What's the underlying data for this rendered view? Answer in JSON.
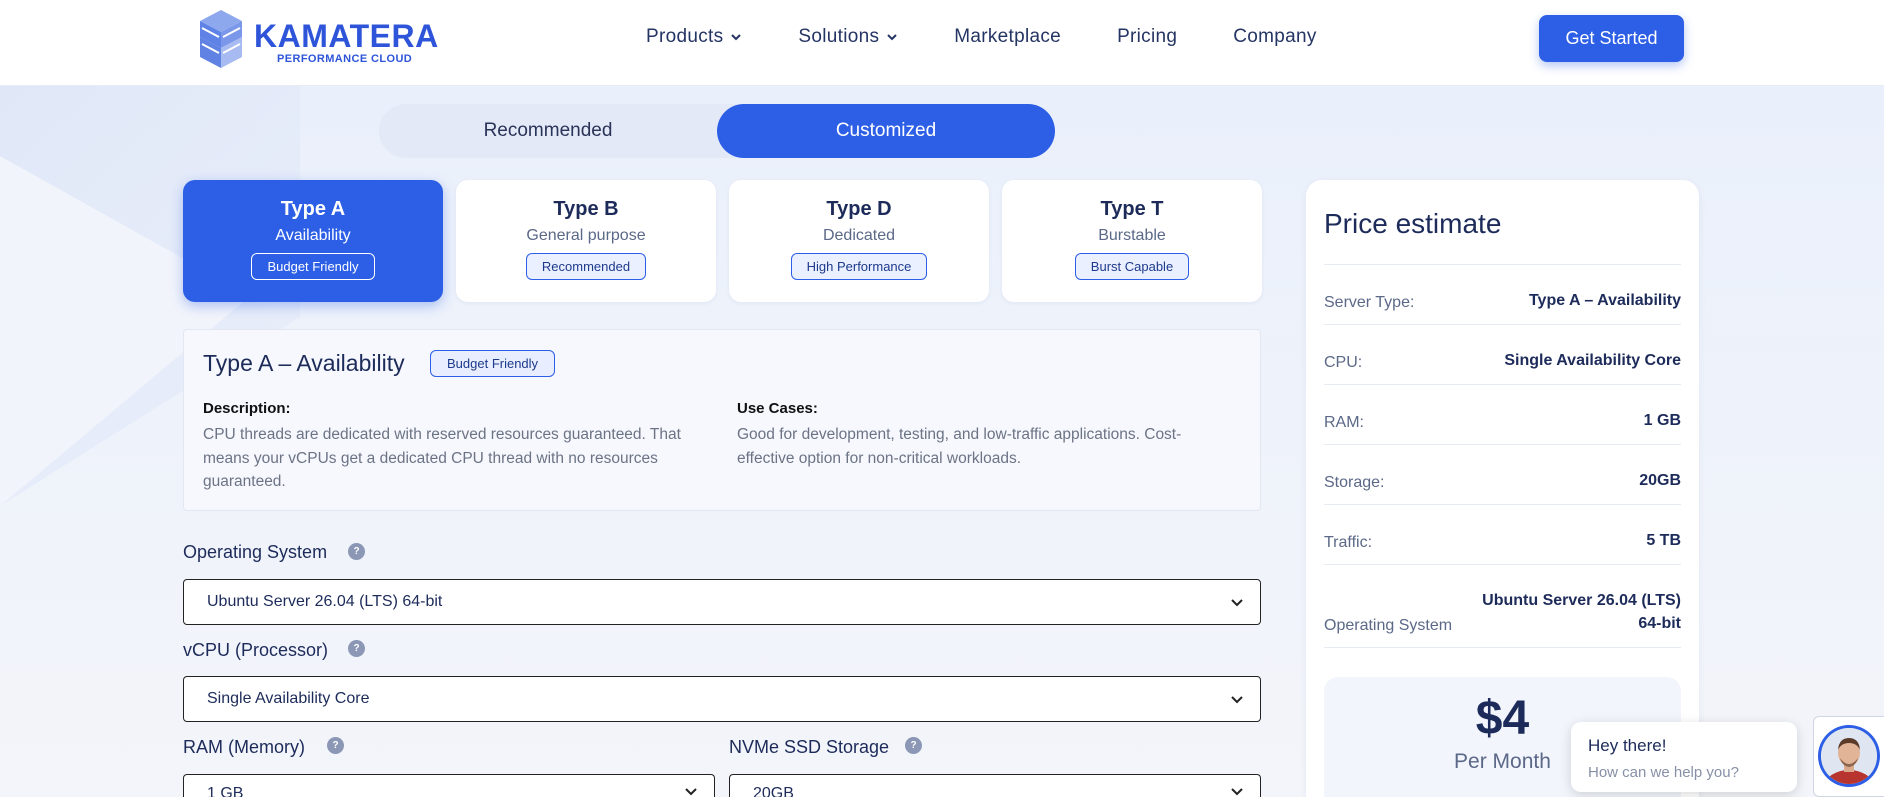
{
  "header": {
    "logo": {
      "name": "KAMATERA",
      "tagline": "PERFORMANCE CLOUD"
    },
    "nav": [
      {
        "label": "Products",
        "dropdown": true
      },
      {
        "label": "Solutions",
        "dropdown": true
      },
      {
        "label": "Marketplace",
        "dropdown": false
      },
      {
        "label": "Pricing",
        "dropdown": false
      },
      {
        "label": "Company",
        "dropdown": false
      }
    ],
    "cta_label": "Get Started"
  },
  "mode_toggle": {
    "left": "Recommended",
    "right": "Customized",
    "selected": "Customized"
  },
  "server_types": [
    {
      "title": "Type A",
      "subtitle": "Availability",
      "badge": "Budget Friendly",
      "selected": true
    },
    {
      "title": "Type B",
      "subtitle": "General purpose",
      "badge": "Recommended",
      "selected": false
    },
    {
      "title": "Type D",
      "subtitle": "Dedicated",
      "badge": "High Performance",
      "selected": false
    },
    {
      "title": "Type T",
      "subtitle": "Burstable",
      "badge": "Burst Capable",
      "selected": false
    }
  ],
  "details": {
    "title": "Type A – Availability",
    "badge": "Budget Friendly",
    "description_label": "Description:",
    "description": "CPU threads are dedicated with reserved resources guaranteed. That means your vCPUs get a dedicated CPU thread with no resources guaranteed.",
    "use_cases_label": "Use Cases:",
    "use_cases": "Good for development, testing, and low-traffic applications. Cost-effective option for non-critical workloads."
  },
  "form": {
    "os": {
      "label": "Operating System",
      "value": "Ubuntu Server 26.04 (LTS) 64-bit"
    },
    "vcpu": {
      "label": "vCPU (Processor)",
      "value": "Single Availability Core"
    },
    "ram": {
      "label": "RAM (Memory)",
      "value": "1 GB"
    },
    "storage": {
      "label": "NVMe SSD Storage",
      "value": "20GB"
    },
    "help_glyph": "?"
  },
  "price_estimate": {
    "title": "Price estimate",
    "rows": [
      {
        "key": "Server Type:",
        "value": "Type A – Availability"
      },
      {
        "key": "CPU:",
        "value": "Single Availability Core"
      },
      {
        "key": "RAM:",
        "value": "1 GB"
      },
      {
        "key": "Storage:",
        "value": "20GB"
      },
      {
        "key": "Traffic:",
        "value": "5 TB"
      },
      {
        "key": "Operating System",
        "value": "Ubuntu Server 26.04 (LTS) 64-bit"
      }
    ],
    "amount": "$4",
    "period": "Per Month"
  },
  "chat": {
    "greeting": "Hey there!",
    "prompt": "How can we help you?"
  },
  "colors": {
    "accent": "#2c5ee6",
    "text": "#1d2b5a",
    "muted": "#5b6887"
  }
}
